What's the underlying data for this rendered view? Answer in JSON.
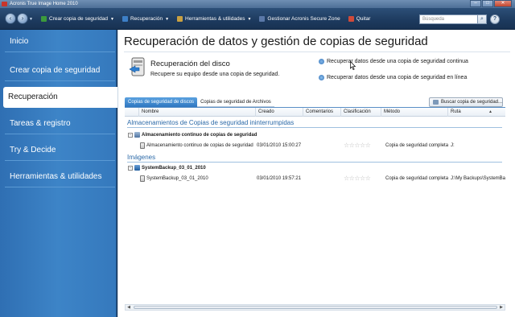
{
  "window": {
    "title": "Acronis True Image Home 2010"
  },
  "toolbar": {
    "menus": [
      {
        "label": "Crear copia de seguridad",
        "icon": "backup-icon",
        "has_caret": true,
        "color": "#3c9a3c"
      },
      {
        "label": "Recuperación",
        "icon": "recovery-icon",
        "has_caret": true,
        "color": "#3d7fc7"
      },
      {
        "label": "Herramientas & utilidades",
        "icon": "tools-icon",
        "has_caret": true,
        "color": "#c9a142"
      },
      {
        "label": "Gestionar Acronis Secure Zone",
        "icon": "secure-zone-icon",
        "has_caret": false,
        "color": "#5a78a8"
      },
      {
        "label": "Quitar",
        "icon": "remove-icon",
        "has_caret": false,
        "color": "#d04a3a"
      }
    ],
    "search_placeholder": "Búsqueda"
  },
  "sidebar": {
    "items": [
      {
        "label": "Inicio",
        "active": false
      },
      {
        "label": "Crear copia de seguridad",
        "active": false
      },
      {
        "label": "Recuperación",
        "active": true
      },
      {
        "label": "Tareas & registro",
        "active": false
      },
      {
        "label": "Try & Decide",
        "active": false
      },
      {
        "label": "Herramientas & utilidades",
        "active": false
      }
    ]
  },
  "main": {
    "title": "Recuperación de datos y gestión de copias de seguridad",
    "disk_recovery": {
      "title": "Recuperación del disco",
      "description": "Recupere su equipo desde una copia de seguridad."
    },
    "actions": [
      "Recuperar datos desde una copia de seguridad continua",
      "Recuperar datos desde una copia de seguridad en línea"
    ],
    "tabs": [
      "Copias de seguridad de discos",
      "Copias de seguridad de Archivos"
    ],
    "find_button": "Buscar copia de seguridad...",
    "columns": [
      "Nombre",
      "Creado",
      "Comentarios",
      "Clasificación",
      "Método",
      "Ruta"
    ],
    "groups": [
      {
        "title": "Almacenamientos de Copias de seguridad ininterrumpidas",
        "parent": "Almacenamiento continuo de copias de seguridad",
        "child": {
          "name": "Almacenamiento continuo de copias de seguridad",
          "created": "03/01/2010 15:00:27",
          "comments": "",
          "rating": "☆☆☆☆☆",
          "method": "Copia de seguridad completa",
          "path": "J:"
        }
      },
      {
        "title": "Imágenes",
        "parent": "SystemBackup_03_01_2010",
        "child": {
          "name": "SystemBackup_03_01_2010",
          "created": "03/01/2010 19:57:21",
          "comments": "",
          "rating": "☆☆☆☆☆",
          "method": "Copia de seguridad completa",
          "path": "J:\\My Backups\\SystemBa"
        }
      }
    ]
  }
}
